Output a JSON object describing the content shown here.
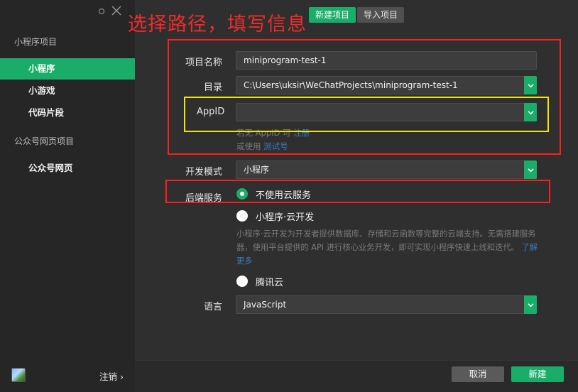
{
  "annotation": {
    "title": "选择路径，填写信息"
  },
  "sidebar": {
    "section1_title": "小程序项目",
    "items": [
      "小程序",
      "小游戏",
      "代码片段"
    ],
    "section2_title": "公众号网页项目",
    "section2_items": [
      "公众号网页"
    ],
    "logout_label": "注销 ›"
  },
  "top_tabs": {
    "new_project": "新建项目",
    "import_project": "导入项目"
  },
  "form": {
    "project_name_label": "项目名称",
    "project_name_value": "miniprogram-test-1",
    "dir_label": "目录",
    "dir_value": "C:\\Users\\uksir\\WeChatProjects\\miniprogram-test-1",
    "appid_label": "AppID",
    "appid_value": "",
    "appid_hint_prefix": "若无 AppID 可 ",
    "appid_hint_link": "注册",
    "appid_hint2_prefix": "或使用 ",
    "appid_hint2_link": "测试号",
    "devmode_label": "开发模式",
    "devmode_value": "小程序",
    "backend_label": "后端服务",
    "backend_opt1": "不使用云服务",
    "backend_opt2": "小程序·云开发",
    "cloud_desc": "小程序·云开发为开发者提供数据库、存储和云函数等完整的云端支持。无需搭建服务器，使用平台提供的 API 进行核心业务开发，即可实现小程序快速上线和迭代。",
    "cloud_desc_link": "了解更多",
    "backend_opt3": "腾讯云",
    "lang_label": "语言",
    "lang_value": "JavaScript"
  },
  "buttons": {
    "cancel": "取消",
    "create": "新建"
  },
  "colors": {
    "accent": "#1aad6a",
    "annotation_red": "#ff1e1e",
    "annotation_yellow": "#f2e300"
  }
}
